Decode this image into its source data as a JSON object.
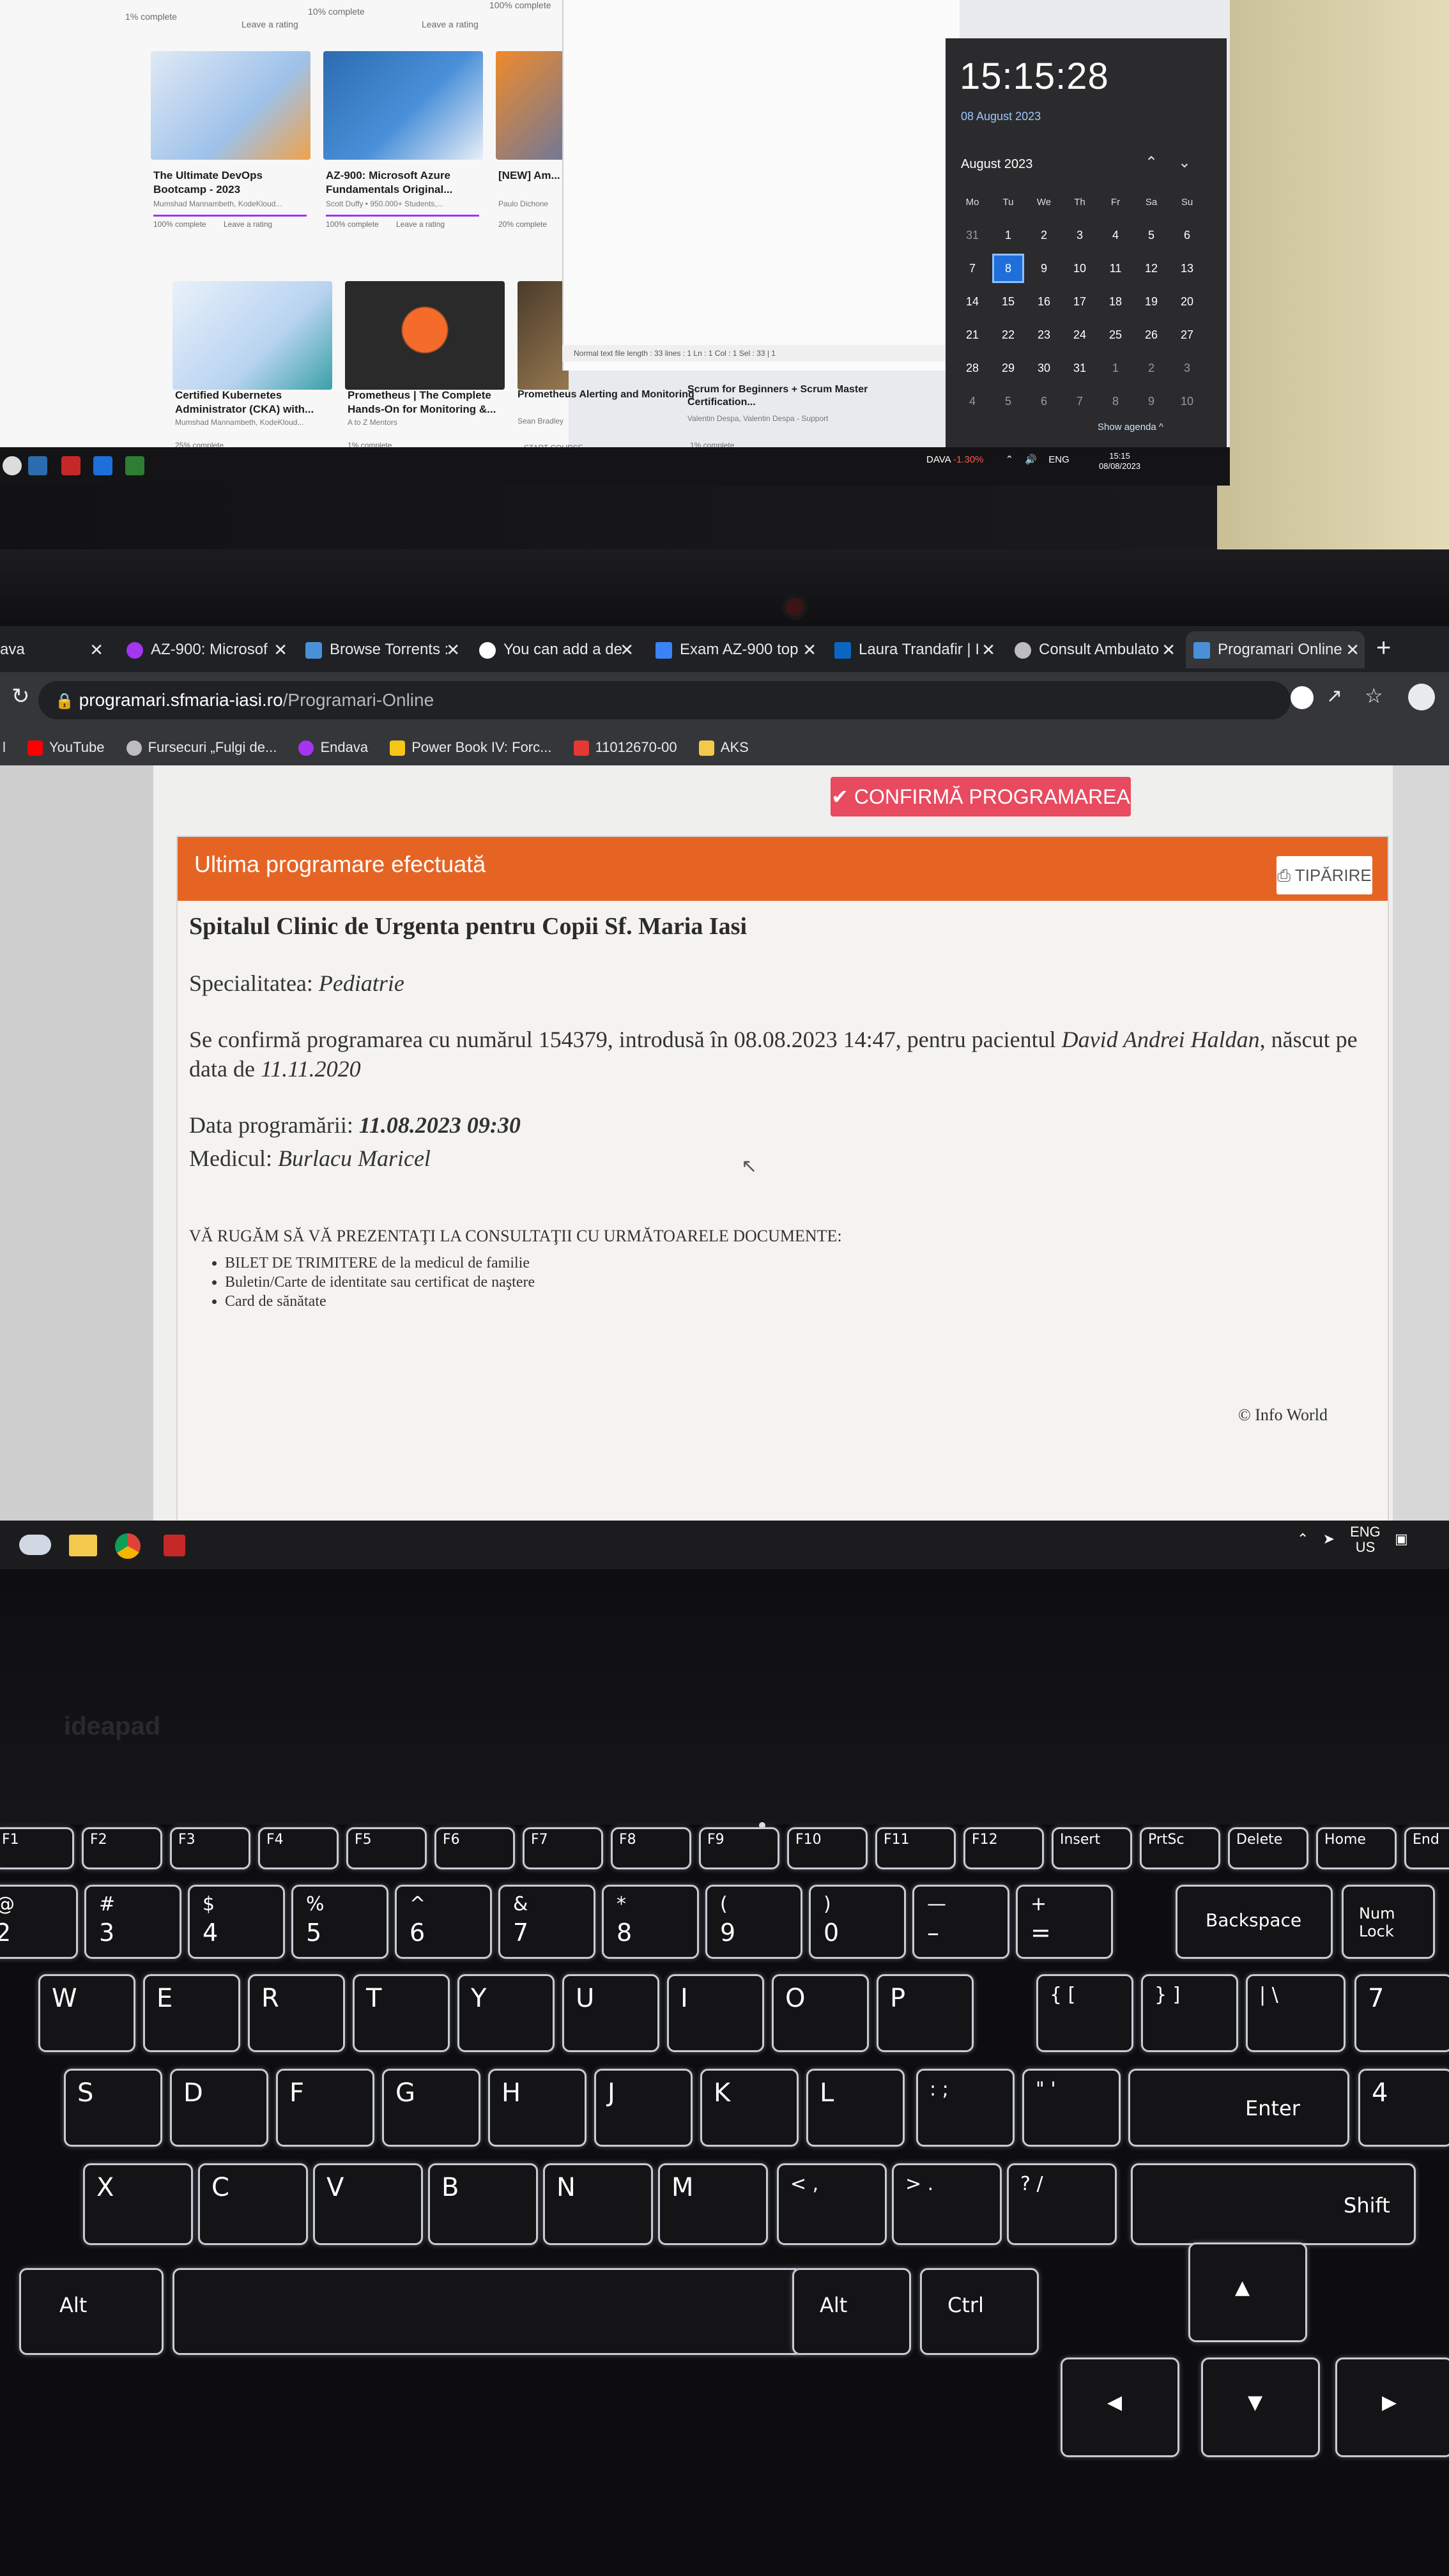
{
  "top_monitor": {
    "course_row_top": {
      "left_text": "1% complete",
      "ratings": [
        "Leave a rating",
        "Leave a rating"
      ],
      "mid": [
        "10% complete",
        "100% complete"
      ]
    },
    "courses": [
      {
        "title": "The Ultimate DevOps Bootcamp - 2023",
        "author": "Mumshad Mannambeth, KodeKloud...",
        "progress": "100% complete",
        "rating": "Leave a rating"
      },
      {
        "title": "AZ-900: Microsoft Azure Fundamentals Original...",
        "author": "Scott Duffy • 950.000+ Students,...",
        "progress": "100% complete",
        "rating": "Leave a rating"
      },
      {
        "title": "[NEW] Am... Masterclas...",
        "author": "Paulo Dichone",
        "progress": "20% complete",
        "rating": ""
      },
      {
        "title": "Certified Kubernetes Administrator (CKA) with...",
        "author": "Mumshad Mannambeth, KodeKloud...",
        "progress": "25% complete",
        "rating": ""
      },
      {
        "title": "Prometheus | The Complete Hands-On for Monitoring &...",
        "author": "A to Z Mentors",
        "progress": "1% complete",
        "rating": ""
      },
      {
        "title": "Prometheus Alerting and Monitoring",
        "author": "Sean Bradley",
        "progress": "START COURSE",
        "rating": ""
      },
      {
        "title": "Scrum for Beginners + Scrum Master Certification...",
        "author": "Valentin Despa, Valentin Despa - Support",
        "progress": "1% complete",
        "rating": ""
      }
    ],
    "notepad_status": "Normal text file   length : 33   lines : 1          Ln : 1   Col : 1   Sel : 33 | 1",
    "clock": {
      "time": "15:15:28",
      "date": "08 August 2023",
      "month": "August 2023",
      "weekdays": [
        "Mo",
        "Tu",
        "We",
        "Th",
        "Fr",
        "Sa",
        "Su"
      ],
      "weeks": [
        [
          "31",
          "1",
          "2",
          "3",
          "4",
          "5",
          "6"
        ],
        [
          "7",
          "8",
          "9",
          "10",
          "11",
          "12",
          "13"
        ],
        [
          "14",
          "15",
          "16",
          "17",
          "18",
          "19",
          "20"
        ],
        [
          "21",
          "22",
          "23",
          "24",
          "25",
          "26",
          "27"
        ],
        [
          "28",
          "29",
          "30",
          "31",
          "1",
          "2",
          "3"
        ],
        [
          "4",
          "5",
          "6",
          "7",
          "8",
          "9",
          "10"
        ]
      ],
      "today": "8",
      "show_agenda": "Show agenda ^"
    },
    "taskbar": {
      "ticker": "DAVA",
      "ticker_change": "-1.30%",
      "lang": "ENG",
      "time": "15:15",
      "date": "08/08/2023"
    }
  },
  "browser": {
    "tabs": [
      {
        "label": "ava",
        "fav_color": "#9aa0a6"
      },
      {
        "label": "AZ-900: Microsof",
        "fav_color": "#a435f0"
      },
      {
        "label": "Browse Torrents :",
        "fav_color": "#4a90d9"
      },
      {
        "label": "You can add a de",
        "fav_color": "#ffffff"
      },
      {
        "label": "Exam AZ-900 top",
        "fav_color": "#3b82f6"
      },
      {
        "label": "Laura Trandafir | I",
        "fav_color": "#0a66c2"
      },
      {
        "label": "Consult Ambulato",
        "fav_color": "#bdbdbd"
      },
      {
        "label": "Programari Online",
        "fav_color": "#4a90d9"
      }
    ],
    "url_host": "programari.sfmaria-iasi.ro",
    "url_path": "/Programari-Online",
    "bookmarks": [
      {
        "label": "YouTube",
        "color": "#ff0000"
      },
      {
        "label": "Fursecuri „Fulgi de...",
        "color": "#bdbdbd"
      },
      {
        "label": "Endava",
        "color": "#a435f0"
      },
      {
        "label": "Power Book IV: Forc...",
        "color": "#f5c518"
      },
      {
        "label": "11012670-00",
        "color": "#e53935"
      },
      {
        "label": "AKS",
        "color": "#f2c94c"
      }
    ]
  },
  "page": {
    "confirm_button": "CONFIRMĂ PROGRAMAREA",
    "card_title": "Ultima programare efectuată",
    "print_button": "TIPĂRIRE",
    "hospital": "Spitalul Clinic de Urgenta pentru Copii Sf. Maria Iasi",
    "specialty_label": "Specialitatea:",
    "specialty": "Pediatrie",
    "confirm_prefix": "Se confirmă programarea cu numărul 154379, introdusă în 08.08.2023 14:47, pentru pacientul",
    "patient": "David Andrei Haldan",
    "born_prefix": ", născut pe data de",
    "birth_date": "11.11.2020",
    "date_label": "Data programării:",
    "appointment": "11.08.2023 09:30",
    "doctor_label": "Medicul:",
    "doctor": "Burlacu Maricel",
    "docs_heading": "VĂ RUGĂM SĂ VĂ PREZENTAŢI LA CONSULTAŢII CU URMĂTOARELE DOCUMENTE:",
    "docs": [
      "BILET DE TRIMITERE de la medicul de familie",
      "Buletin/Carte de identitate sau certificat de naştere",
      "Card de sănătate"
    ],
    "credit": "© Info World"
  },
  "laptop_tray": {
    "lang": "ENG",
    "region": "US"
  },
  "keyboard": {
    "fn_row": [
      "F1",
      "F2",
      "F3",
      "F4",
      "F5",
      "F6",
      "F7",
      "F8",
      "F9",
      "F10",
      "F11",
      "F12",
      "Insert",
      "PrtSc",
      "Delete",
      "Home",
      "End"
    ],
    "num_row": [
      {
        "top": "@",
        "bot": "2"
      },
      {
        "top": "#",
        "bot": "3"
      },
      {
        "top": "$",
        "bot": "4"
      },
      {
        "top": "%",
        "bot": "5"
      },
      {
        "top": "^",
        "bot": "6"
      },
      {
        "top": "&",
        "bot": "7"
      },
      {
        "top": "*",
        "bot": "8"
      },
      {
        "top": "(",
        "bot": "9"
      },
      {
        "top": ")",
        "bot": "0"
      },
      {
        "top": "—",
        "bot": "–"
      },
      {
        "top": "+",
        "bot": "="
      }
    ],
    "backspace": "Backspace",
    "numlock": "Num Lock",
    "row_q": [
      "W",
      "E",
      "R",
      "T",
      "Y",
      "U",
      "I",
      "O",
      "P"
    ],
    "row_a": [
      "S",
      "D",
      "F",
      "G",
      "H",
      "J",
      "K",
      "L"
    ],
    "row_z": [
      "X",
      "C",
      "V",
      "B",
      "N",
      "M"
    ],
    "enter": "Enter",
    "shift": "Shift",
    "alt": "Alt",
    "ctrl": "Ctrl",
    "num7": "7",
    "num4": "4",
    "home": "Home"
  },
  "colors": {
    "accent_orange": "#e66423",
    "confirm_red": "#e84a5f",
    "calendar_today": "#1e6fd9"
  }
}
